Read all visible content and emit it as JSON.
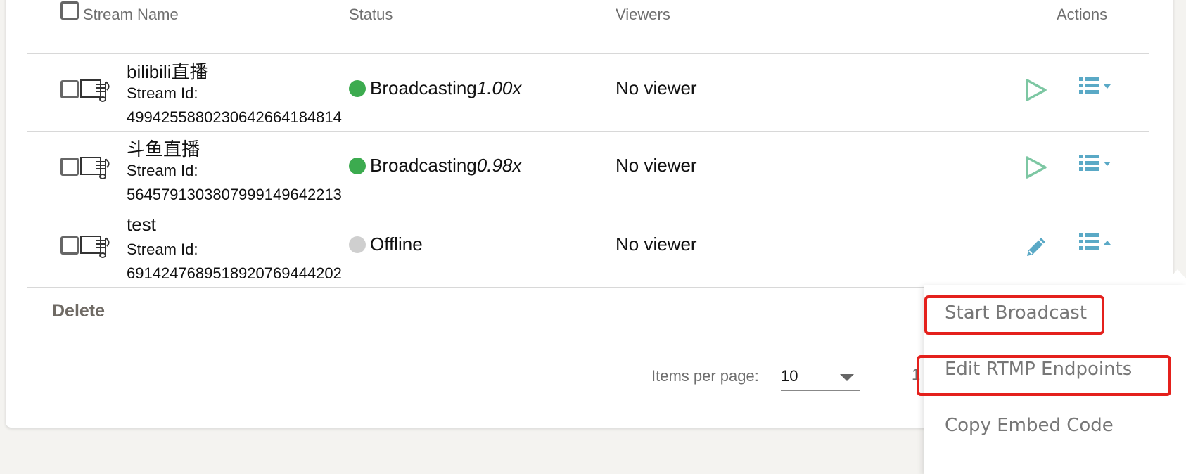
{
  "table": {
    "headers": {
      "stream_name": "Stream Name",
      "status": "Status",
      "viewers": "Viewers",
      "actions": "Actions"
    },
    "rows": [
      {
        "name": "bilibili直播",
        "stream_id_label": "Stream Id:",
        "stream_id": "4994255880230642664184814",
        "status": "Broadcasting",
        "speed": "1.00x",
        "status_color": "#3cab4f",
        "viewers": "No viewer",
        "primary_action": "play-icon"
      },
      {
        "name": "斗鱼直播",
        "stream_id_label": "Stream Id:",
        "stream_id": "5645791303807999149642213",
        "status": "Broadcasting",
        "speed": "0.98x",
        "status_color": "#3cab4f",
        "viewers": "No viewer",
        "primary_action": "play-icon"
      },
      {
        "name": "test",
        "stream_id_label": "Stream Id:",
        "stream_id": "6914247689518920769444202",
        "status": "Offline",
        "speed": "",
        "status_color": "#cfcfcf",
        "viewers": "No viewer",
        "primary_action": "pencil-icon"
      }
    ]
  },
  "footer": {
    "delete_label": "Delete",
    "items_per_page_label": "Items per page:",
    "items_per_page_value": "10",
    "range_partial": "1"
  },
  "dropdown_menu": {
    "items": [
      "Start Broadcast",
      "Edit RTMP Endpoints",
      "Copy Embed Code"
    ]
  },
  "colors": {
    "accent_teal": "#5aa9c6",
    "play_green": "#7dc7a3",
    "highlight_red": "#e4201c"
  }
}
